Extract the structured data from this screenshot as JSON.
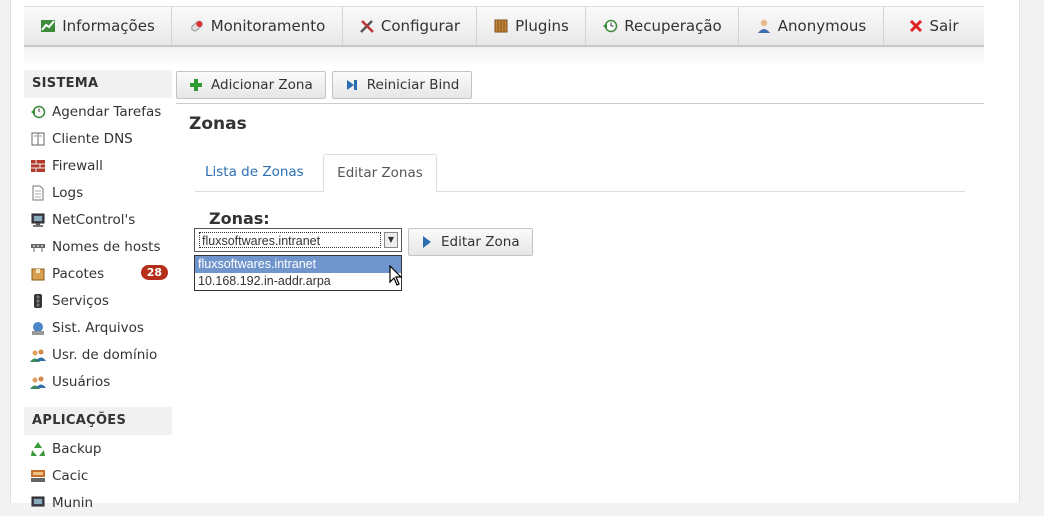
{
  "nav": [
    {
      "label": "Informações",
      "icon": "chart-icon",
      "width": 148
    },
    {
      "label": "Monitoramento",
      "icon": "pill-icon",
      "width": 171
    },
    {
      "label": "Configurar",
      "icon": "tools-icon",
      "width": 134
    },
    {
      "label": "Plugins",
      "icon": "package-icon",
      "width": 109
    },
    {
      "label": "Recuperação",
      "icon": "restore-icon",
      "width": 153
    },
    {
      "label": "Anonymous",
      "icon": "user-icon",
      "width": 145
    },
    {
      "label": "Sair",
      "icon": "close-icon",
      "width": 100
    }
  ],
  "sidebar": {
    "sistema_title": "SISTEMA",
    "sistema_items": [
      {
        "label": "Agendar Tarefas",
        "icon": "clock-arrow-icon"
      },
      {
        "label": "Cliente DNS",
        "icon": "book-icon"
      },
      {
        "label": "Firewall",
        "icon": "brick-wall-icon"
      },
      {
        "label": "Logs",
        "icon": "document-icon"
      },
      {
        "label": "NetControl's",
        "icon": "monitor-icon"
      },
      {
        "label": "Nomes de hosts",
        "icon": "network-icon"
      },
      {
        "label": "Pacotes",
        "icon": "box-icon",
        "badge": "28"
      },
      {
        "label": "Serviços",
        "icon": "traffic-light-icon"
      },
      {
        "label": "Sist. Arquivos",
        "icon": "drive-icon"
      },
      {
        "label": "Usr. de domínio",
        "icon": "users-icon"
      },
      {
        "label": "Usuários",
        "icon": "users-icon"
      }
    ],
    "aplicacoes_title": "APLICAÇÕES",
    "aplicacoes_items": [
      {
        "label": "Backup",
        "icon": "recycle-icon"
      },
      {
        "label": "Cacic",
        "icon": "computer-icon"
      },
      {
        "label": "Munin",
        "icon": "monitor-icon"
      }
    ]
  },
  "toolbar": {
    "add_zone": "Adicionar Zona",
    "restart_bind": "Reiniciar Bind"
  },
  "main": {
    "title": "Zonas",
    "tabs": [
      {
        "label": "Lista de Zonas"
      },
      {
        "label": "Editar Zonas"
      }
    ],
    "form_label": "Zonas:",
    "select_value": "fluxsoftwares.intranet",
    "edit_button": "Editar Zona",
    "options": [
      "fluxsoftwares.intranet",
      "10.168.192.in-addr.arpa"
    ]
  },
  "colors": {
    "badge": "#b62f1b",
    "link": "#2a6fb3",
    "selected_option": "#7095cc"
  }
}
